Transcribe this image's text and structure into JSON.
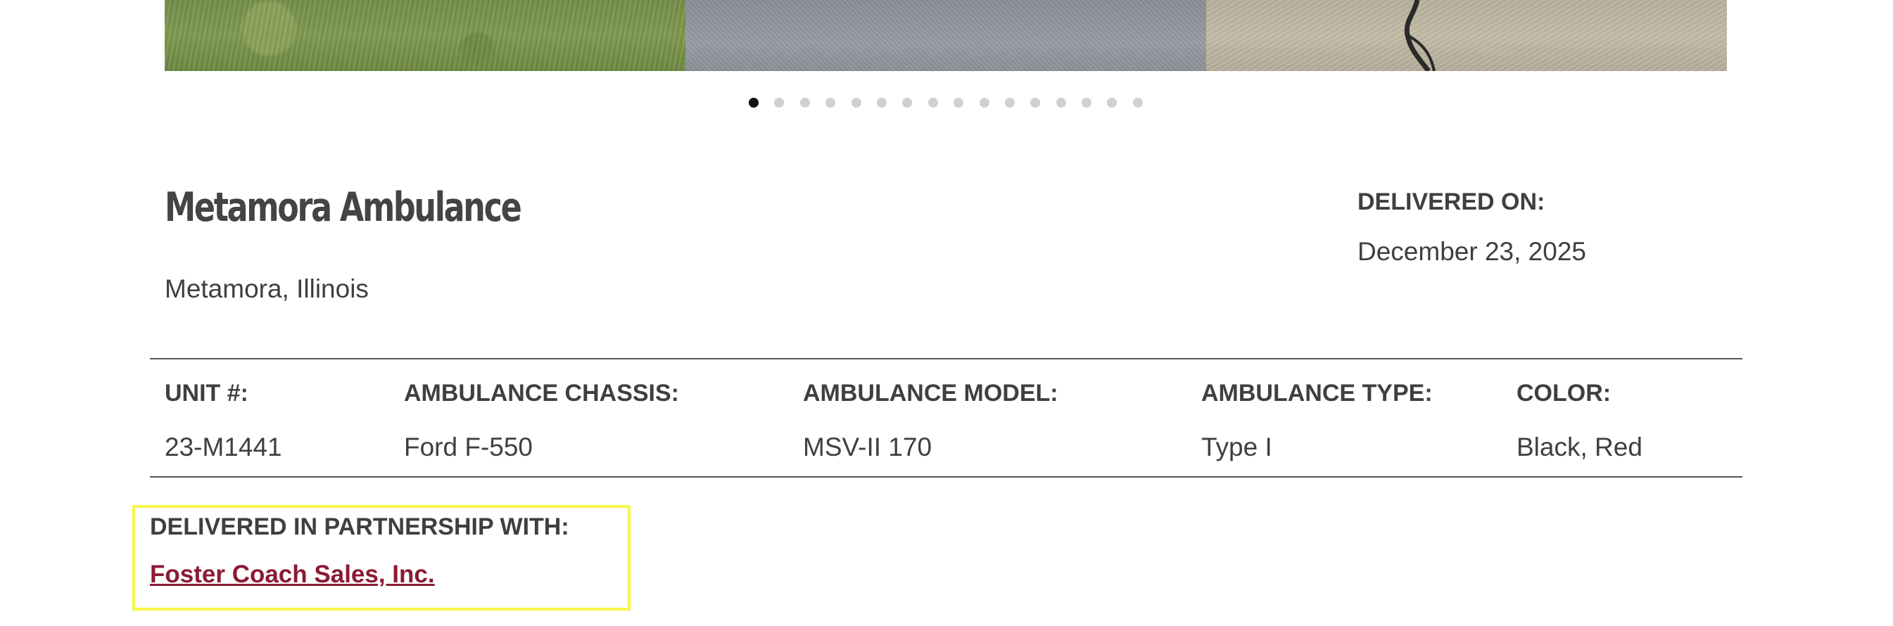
{
  "gallery": {
    "photos": [
      "grass-photo",
      "asphalt-photo",
      "concrete-photo"
    ],
    "dot_count": 16,
    "active_index": 0
  },
  "header": {
    "title": "Metamora Ambulance",
    "location": "Metamora, Illinois",
    "delivered_label": "DELIVERED ON:",
    "delivered_value": "December 23, 2025"
  },
  "specs": [
    {
      "label": "UNIT #:",
      "value": "23-M1441"
    },
    {
      "label": "AMBULANCE CHASSIS:",
      "value": "Ford F-550"
    },
    {
      "label": "AMBULANCE MODEL:",
      "value": "MSV-II 170"
    },
    {
      "label": "AMBULANCE TYPE:",
      "value": "Type I"
    },
    {
      "label": "COLOR:",
      "value": "Black, Red"
    }
  ],
  "partnership": {
    "label": "DELIVERED IN PARTNERSHIP WITH:",
    "link_text": "Foster Coach Sales, Inc."
  },
  "colors": {
    "link": "#8b1a33",
    "highlight_box": "#f7f54b",
    "text": "#3f3f3f",
    "dot_active": "#111111",
    "dot_inactive": "#d0d0d0"
  }
}
